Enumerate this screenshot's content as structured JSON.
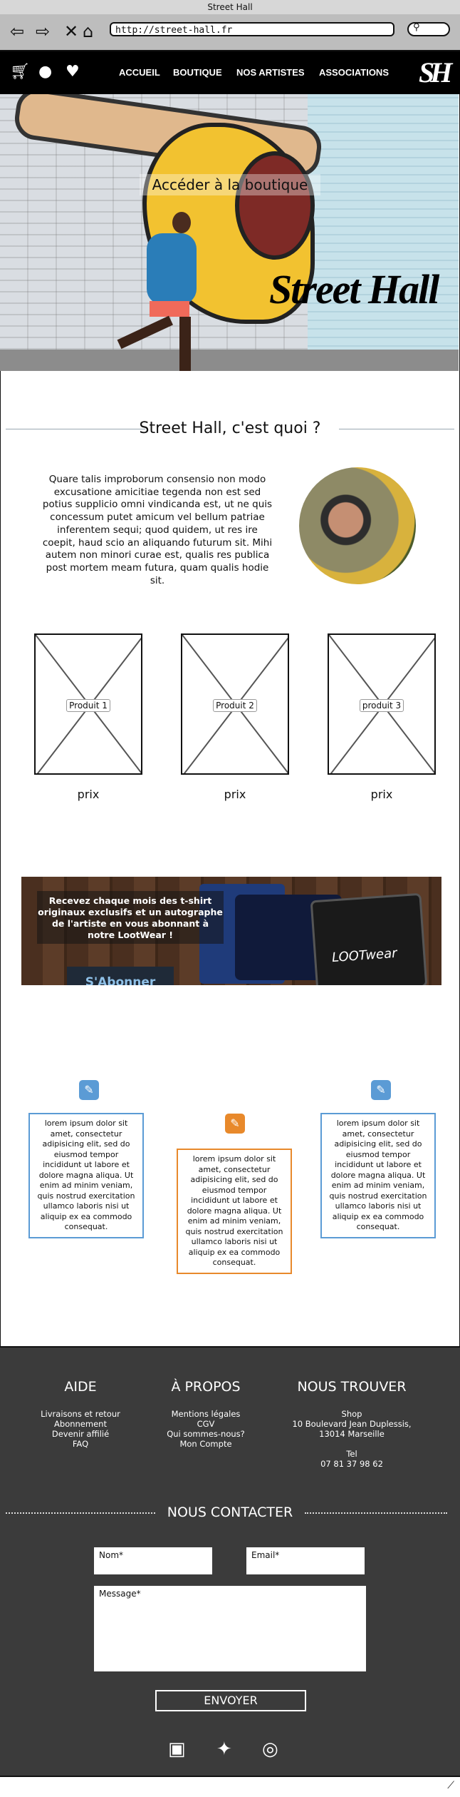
{
  "window": {
    "title": "Street Hall"
  },
  "browser": {
    "url": "http://street-hall.fr",
    "icons": [
      "back-arrow-icon",
      "forward-arrow-icon",
      "close-icon",
      "home-icon",
      "search-icon"
    ]
  },
  "nav": {
    "icons": [
      "cart-icon",
      "user-icon",
      "heart-icon"
    ],
    "links": [
      "ACCUEIL",
      "BOUTIQUE",
      "NOS ARTISTES",
      "ASSOCIATIONS"
    ],
    "logo": "SH"
  },
  "hero": {
    "cta": "Accéder à la boutique",
    "wordmark": "Street Hall"
  },
  "about": {
    "title": "Street Hall, c'est quoi ?",
    "text": "Quare talis improborum consensio non modo excusatione amicitiae tegenda non est sed potius supplicio omni vindicanda est, ut ne quis concessum putet amicum vel bellum patriae inferentem sequi; quod quidem, ut res ire coepit, haud scio an aliquando futurum sit. Mihi autem non minori curae est, qualis res publica post mortem meam futura, quam qualis hodie sit."
  },
  "products": [
    {
      "label": "Produit 1",
      "price": "prix"
    },
    {
      "label": "Produit 2",
      "price": "prix"
    },
    {
      "label": "produit 3",
      "price": "prix"
    }
  ],
  "promo": {
    "message": "Recevez chaque mois des t-shirt originaux exclusifs et un autographe de l'artiste en vous abonnant à notre LootWear !",
    "button": "S'Abonner",
    "box_label": "LOOTwear"
  },
  "features": [
    {
      "icon": "edit-icon",
      "color": "#5b9bd5",
      "text": "lorem ipsum dolor sit amet, consectetur adipisicing elit, sed do eiusmod tempor incididunt ut labore et dolore magna aliqua. Ut enim ad minim veniam, quis nostrud exercitation ullamco laboris nisi ut aliquip ex ea commodo consequat."
    },
    {
      "icon": "edit-icon",
      "color": "#e8892b",
      "text": "lorem ipsum dolor sit amet, consectetur adipisicing elit, sed do eiusmod tempor incididunt ut labore et dolore magna aliqua. Ut enim ad minim veniam, quis nostrud exercitation ullamco laboris nisi ut aliquip ex ea commodo consequat."
    },
    {
      "icon": "edit-icon",
      "color": "#5b9bd5",
      "text": "lorem ipsum dolor sit amet, consectetur adipisicing elit, sed do eiusmod tempor incididunt ut labore et dolore magna aliqua. Ut enim ad minim veniam, quis nostrud exercitation ullamco laboris nisi ut aliquip ex ea commodo consequat."
    }
  ],
  "footer": {
    "aide": {
      "title": "AIDE",
      "items": [
        "Livraisons et retour",
        "Abonnement",
        "Devenir affilié",
        "FAQ"
      ]
    },
    "apropos": {
      "title": "À PROPOS",
      "items": [
        "Mentions légales",
        "CGV",
        "Qui sommes-nous?",
        "Mon Compte"
      ]
    },
    "trouver": {
      "title": "NOUS TROUVER",
      "items": [
        "Shop",
        "10 Boulevard Jean Duplessis,",
        "13014 Marseille",
        "",
        "Tel",
        "07 81 37 98 62"
      ]
    },
    "contact": {
      "title": "NOUS CONTACTER",
      "name_placeholder": "Nom*",
      "email_placeholder": "Email*",
      "message_placeholder": "Message*",
      "send": "ENVOYER"
    },
    "social": [
      "facebook-icon",
      "twitter-icon",
      "instagram-icon"
    ]
  }
}
